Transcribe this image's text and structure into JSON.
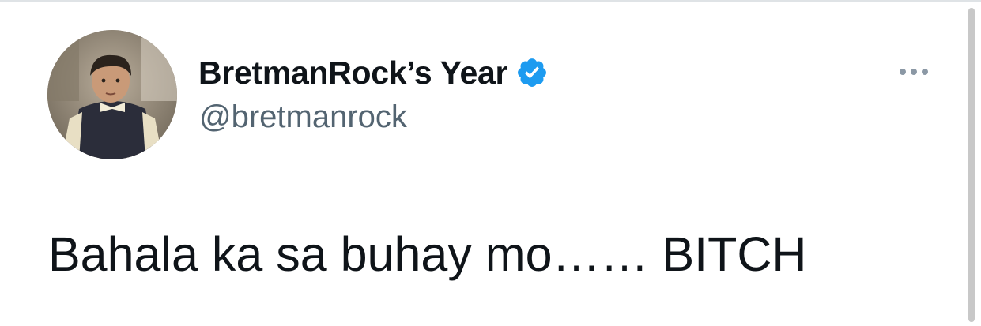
{
  "tweet": {
    "display_name": "BretmanRock’s Year",
    "handle": "@bretmanrock",
    "verified": true,
    "text": "Bahala ka sa buhay mo…… BITCH",
    "avatar_icon": "profile-photo-child",
    "more_icon": "ellipsis-icon"
  },
  "colors": {
    "name": "#0f1419",
    "handle": "#536471",
    "verified_badge": "#1d9bf0",
    "more_dots": "#8b98a5"
  }
}
